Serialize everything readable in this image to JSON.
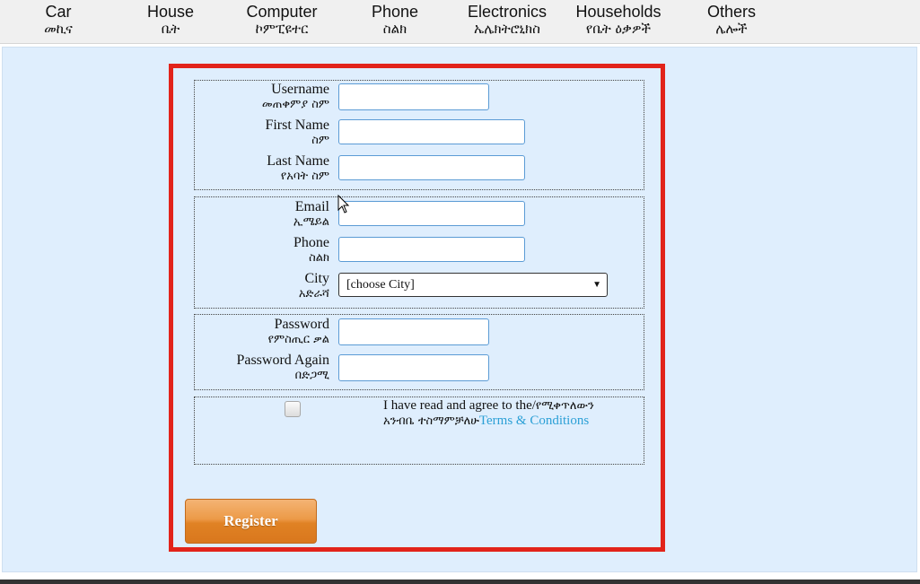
{
  "nav": [
    {
      "en": "Car",
      "am": "መኪና"
    },
    {
      "en": "House",
      "am": "ቤት"
    },
    {
      "en": "Computer",
      "am": "ኮምፒዩተር"
    },
    {
      "en": "Phone",
      "am": "ስልክ"
    },
    {
      "en": "Electronics",
      "am": "ኤሌክትሮኒክስ"
    },
    {
      "en": "Households",
      "am": "የቤት ዕቃዎች"
    },
    {
      "en": "Others",
      "am": "ሌሎች"
    }
  ],
  "form": {
    "username": {
      "en": "Username",
      "am": "መጠቀምያ ስም",
      "value": ""
    },
    "first_name": {
      "en": "First Name",
      "am": "ስም",
      "value": ""
    },
    "last_name": {
      "en": "Last Name",
      "am": "የአባት ስም",
      "value": ""
    },
    "email": {
      "en": "Email",
      "am": "ኢሜይል",
      "value": ""
    },
    "phone": {
      "en": "Phone",
      "am": "ስልክ",
      "value": ""
    },
    "city": {
      "en": "City",
      "am": "አድራሻ",
      "selected": "[choose City]"
    },
    "password": {
      "en": "Password",
      "am": "የምስጢር ቃል",
      "value": ""
    },
    "password_again": {
      "en": "Password Again",
      "am": "በድጋሚ",
      "value": ""
    },
    "terms": {
      "text_en": "I have read and agree to the/",
      "text_am": "የሚቀጥለውን አንብቤ ተስማምቻለሁ",
      "link": "Terms & Conditions",
      "checked": false
    },
    "register_label": "Register"
  },
  "colors": {
    "accent_border": "#e2231a",
    "link": "#2ca0d6",
    "button": "#e08224",
    "panel_bg": "#dfeefd"
  }
}
